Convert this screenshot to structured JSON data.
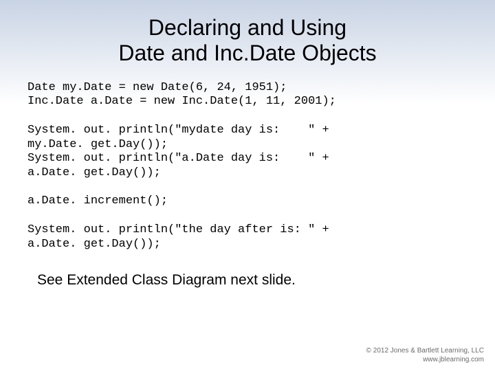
{
  "title_line1": "Declaring and Using",
  "title_line2": "Date and Inc.Date Objects",
  "code": "Date my.Date = new Date(6, 24, 1951);\nInc.Date a.Date = new Inc.Date(1, 11, 2001);\n\nSystem. out. println(\"mydate day is:    \" +\nmy.Date. get.Day());\nSystem. out. println(\"a.Date day is:    \" +\na.Date. get.Day());\n\na.Date. increment();\n\nSystem. out. println(\"the day after is: \" +\na.Date. get.Day());",
  "footer_note": "See Extended Class Diagram next slide.",
  "copyright_line1": "© 2012 Jones & Bartlett Learning, LLC",
  "copyright_line2": "www.jblearning.com"
}
